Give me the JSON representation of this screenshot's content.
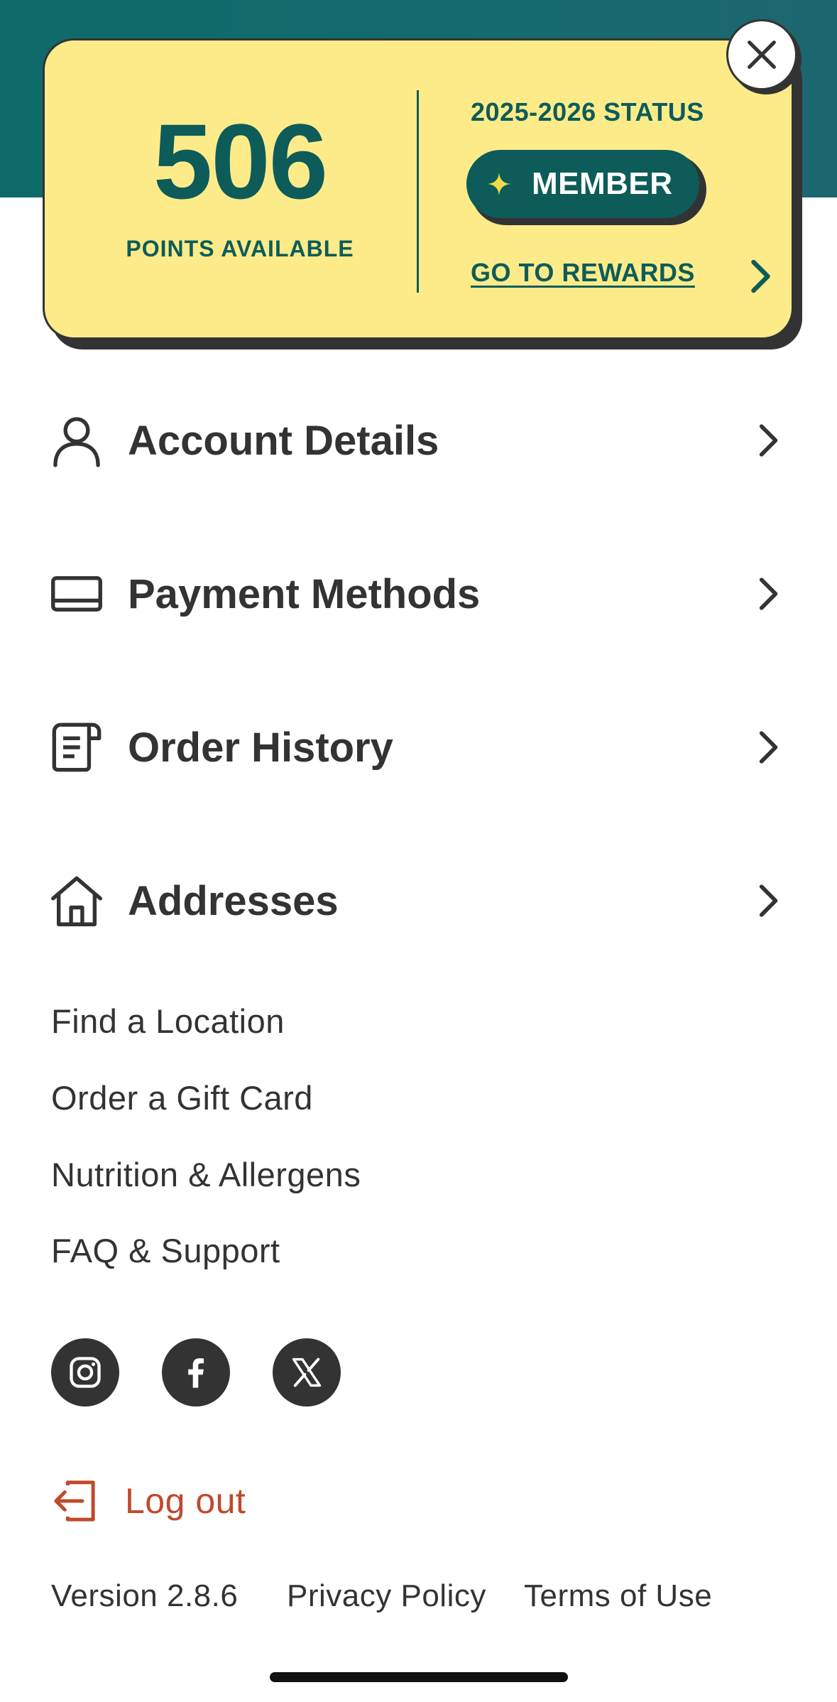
{
  "rewards": {
    "points": "506",
    "points_label": "POINTS AVAILABLE",
    "status_label": "2025-2026 STATUS",
    "tier": "MEMBER",
    "link_label": "GO TO REWARDS"
  },
  "menu": [
    {
      "label": "Account Details",
      "icon": "person-icon"
    },
    {
      "label": "Payment Methods",
      "icon": "card-icon"
    },
    {
      "label": "Order History",
      "icon": "receipt-icon"
    },
    {
      "label": "Addresses",
      "icon": "home-icon"
    }
  ],
  "links": [
    "Find a Location",
    "Order a Gift Card",
    "Nutrition & Allergens",
    "FAQ & Support"
  ],
  "social": [
    "instagram-icon",
    "facebook-icon",
    "x-icon"
  ],
  "logout_label": "Log out",
  "footer": {
    "version": "Version 2.8.6",
    "privacy": "Privacy Policy",
    "terms": "Terms of Use"
  },
  "colors": {
    "brand_teal": "#0d5c59",
    "card_yellow": "#fdeb8a",
    "logout_red": "#c0492b",
    "text_dark": "#333333"
  }
}
